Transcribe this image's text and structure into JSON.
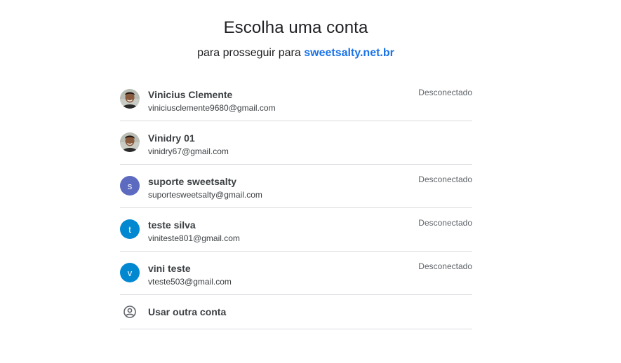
{
  "header": {
    "title": "Escolha uma conta",
    "subtitle_prefix": "para prosseguir para",
    "site": "sweetsalty.net.br"
  },
  "accounts": [
    {
      "name": "Vinicius Clemente",
      "email": "viniciusclemente9680@gmail.com",
      "status": "Desconectado",
      "avatar": {
        "type": "photo",
        "icon": "profile-photo"
      }
    },
    {
      "name": "Vinidry 01",
      "email": "vinidry67@gmail.com",
      "status": "",
      "avatar": {
        "type": "photo",
        "icon": "profile-photo"
      }
    },
    {
      "name": "suporte sweetsalty",
      "email": "suportesweetsalty@gmail.com",
      "status": "Desconectado",
      "avatar": {
        "type": "letter",
        "letter": "s",
        "color": "#5c6bc0"
      }
    },
    {
      "name": "teste silva",
      "email": "viniteste801@gmail.com",
      "status": "Desconectado",
      "avatar": {
        "type": "letter",
        "letter": "t",
        "color": "#0288d1"
      }
    },
    {
      "name": "vini teste",
      "email": "vteste503@gmail.com",
      "status": "Desconectado",
      "avatar": {
        "type": "letter",
        "letter": "v",
        "color": "#0288d1"
      }
    }
  ],
  "other_account": {
    "label": "Usar outra conta",
    "icon": "account-circle-icon"
  },
  "colors": {
    "link": "#1a73e8",
    "divider": "#dadce0",
    "text": "#202124",
    "muted": "#5f6368"
  }
}
